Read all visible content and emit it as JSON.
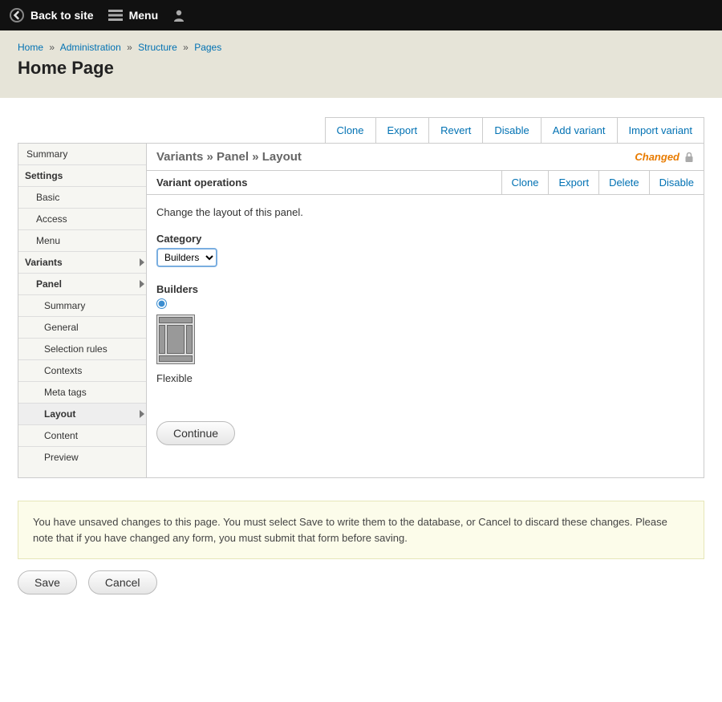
{
  "topbar": {
    "back": "Back to site",
    "menu": "Menu"
  },
  "breadcrumb": {
    "items": [
      "Home",
      "Administration",
      "Structure",
      "Pages"
    ],
    "sep": "»"
  },
  "page_title": "Home Page",
  "primary_tabs": [
    "Clone",
    "Export",
    "Revert",
    "Disable",
    "Add variant",
    "Import variant"
  ],
  "sidebar": {
    "summary": "Summary",
    "settings": "Settings",
    "basic": "Basic",
    "access": "Access",
    "menu": "Menu",
    "variants": "Variants",
    "panel": "Panel",
    "p_summary": "Summary",
    "p_general": "General",
    "p_selection": "Selection rules",
    "p_contexts": "Contexts",
    "p_meta": "Meta tags",
    "p_layout": "Layout",
    "p_content": "Content",
    "p_preview": "Preview"
  },
  "panel": {
    "title": "Variants » Panel » Layout",
    "status": "Changed",
    "sub_title": "Variant operations",
    "sub_actions": [
      "Clone",
      "Export",
      "Delete",
      "Disable"
    ],
    "description": "Change the layout of this panel.",
    "category_label": "Category",
    "category_value": "Builders",
    "builders_label": "Builders",
    "layout_name": "Flexible",
    "continue": "Continue"
  },
  "notice": "You have unsaved changes to this page. You must select Save to write them to the database, or Cancel to discard these changes. Please note that if you have changed any form, you must submit that form before saving.",
  "buttons": {
    "save": "Save",
    "cancel": "Cancel"
  }
}
